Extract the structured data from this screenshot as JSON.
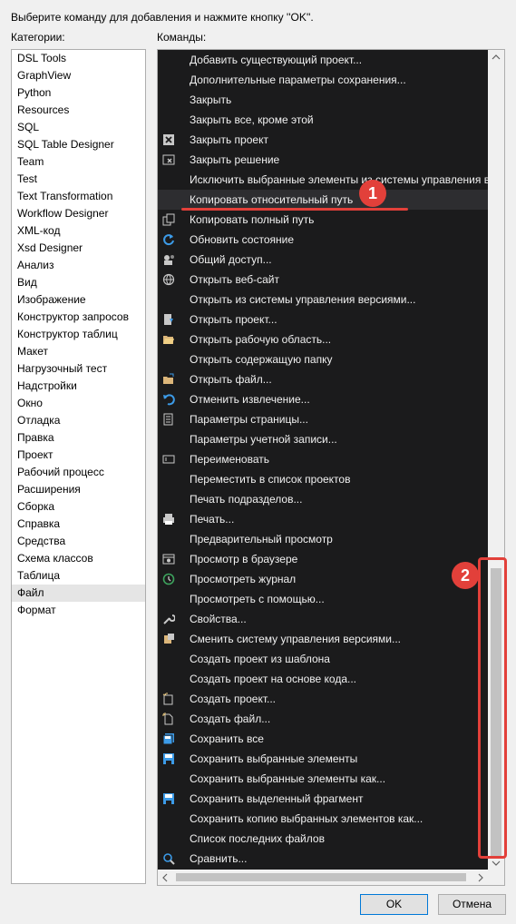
{
  "dialog": {
    "instruction": "Выберите команду для добавления и нажмите кнопку ''OK''.",
    "categories_label": "Категории:",
    "commands_label": "Команды:",
    "ok_label": "OK",
    "cancel_label": "Отмена"
  },
  "categories": [
    "DSL Tools",
    "GraphView",
    "Python",
    "Resources",
    "SQL",
    "SQL Table Designer",
    "Team",
    "Test",
    "Text Transformation",
    "Workflow Designer",
    "XML-код",
    "Xsd Designer",
    "Анализ",
    "Вид",
    "Изображение",
    "Конструктор запросов",
    "Конструктор таблиц",
    "Макет",
    "Нагрузочный тест",
    "Надстройки",
    "Окно",
    "Отладка",
    "Правка",
    "Проект",
    "Рабочий процесс",
    "Расширения",
    "Сборка",
    "Справка",
    "Средства",
    "Схема классов",
    "Таблица",
    "Файл",
    "Формат"
  ],
  "selected_category": "Файл",
  "commands": [
    {
      "label": "Добавить существующий проект...",
      "icon": ""
    },
    {
      "label": "Дополнительные параметры сохранения...",
      "icon": ""
    },
    {
      "label": "Закрыть",
      "icon": ""
    },
    {
      "label": "Закрыть все, кроме этой",
      "icon": ""
    },
    {
      "label": "Закрыть проект",
      "icon": "close-project-icon"
    },
    {
      "label": "Закрыть решение",
      "icon": "close-solution-icon"
    },
    {
      "label": "Исключить выбранные элементы из системы управления версиями",
      "icon": ""
    },
    {
      "label": "Копировать относительный путь",
      "icon": "",
      "selected": true
    },
    {
      "label": "Копировать полный путь",
      "icon": "copy-icon"
    },
    {
      "label": "Обновить состояние",
      "icon": "refresh-icon"
    },
    {
      "label": "Общий доступ...",
      "icon": "share-icon"
    },
    {
      "label": "Открыть веб-сайт",
      "icon": "globe-icon"
    },
    {
      "label": "Открыть из системы управления версиями...",
      "icon": ""
    },
    {
      "label": "Открыть проект...",
      "icon": "open-project-icon"
    },
    {
      "label": "Открыть рабочую область...",
      "icon": "folder-open-icon"
    },
    {
      "label": "Открыть содержащую папку",
      "icon": ""
    },
    {
      "label": "Открыть файл...",
      "icon": "open-file-icon"
    },
    {
      "label": "Отменить извлечение...",
      "icon": "undo-icon"
    },
    {
      "label": "Параметры страницы...",
      "icon": "page-setup-icon"
    },
    {
      "label": "Параметры учетной записи...",
      "icon": ""
    },
    {
      "label": "Переименовать",
      "icon": "rename-icon"
    },
    {
      "label": "Переместить в список проектов",
      "icon": ""
    },
    {
      "label": "Печать подразделов...",
      "icon": ""
    },
    {
      "label": "Печать...",
      "icon": "print-icon"
    },
    {
      "label": "Предварительный просмотр",
      "icon": ""
    },
    {
      "label": "Просмотр в браузере",
      "icon": "browser-icon"
    },
    {
      "label": "Просмотреть журнал",
      "icon": "history-icon"
    },
    {
      "label": "Просмотреть с помощью...",
      "icon": ""
    },
    {
      "label": "Свойства...",
      "icon": "wrench-icon"
    },
    {
      "label": "Сменить систему управления версиями...",
      "icon": "change-source-control-icon"
    },
    {
      "label": "Создать проект из шаблона",
      "icon": ""
    },
    {
      "label": "Создать проект на основе кода...",
      "icon": ""
    },
    {
      "label": "Создать проект...",
      "icon": "new-project-icon"
    },
    {
      "label": "Создать файл...",
      "icon": "new-file-icon"
    },
    {
      "label": "Сохранить все",
      "icon": "save-all-icon"
    },
    {
      "label": "Сохранить выбранные элементы",
      "icon": "save-icon"
    },
    {
      "label": "Сохранить выбранные элементы как...",
      "icon": ""
    },
    {
      "label": "Сохранить выделенный фрагмент",
      "icon": "save-icon"
    },
    {
      "label": "Сохранить копию выбранных элементов как...",
      "icon": ""
    },
    {
      "label": "Список последних файлов",
      "icon": ""
    },
    {
      "label": "Сравнить...",
      "icon": "compare-icon"
    }
  ],
  "annotations": {
    "badge1": "1",
    "badge2": "2",
    "color": "#e2403a"
  }
}
